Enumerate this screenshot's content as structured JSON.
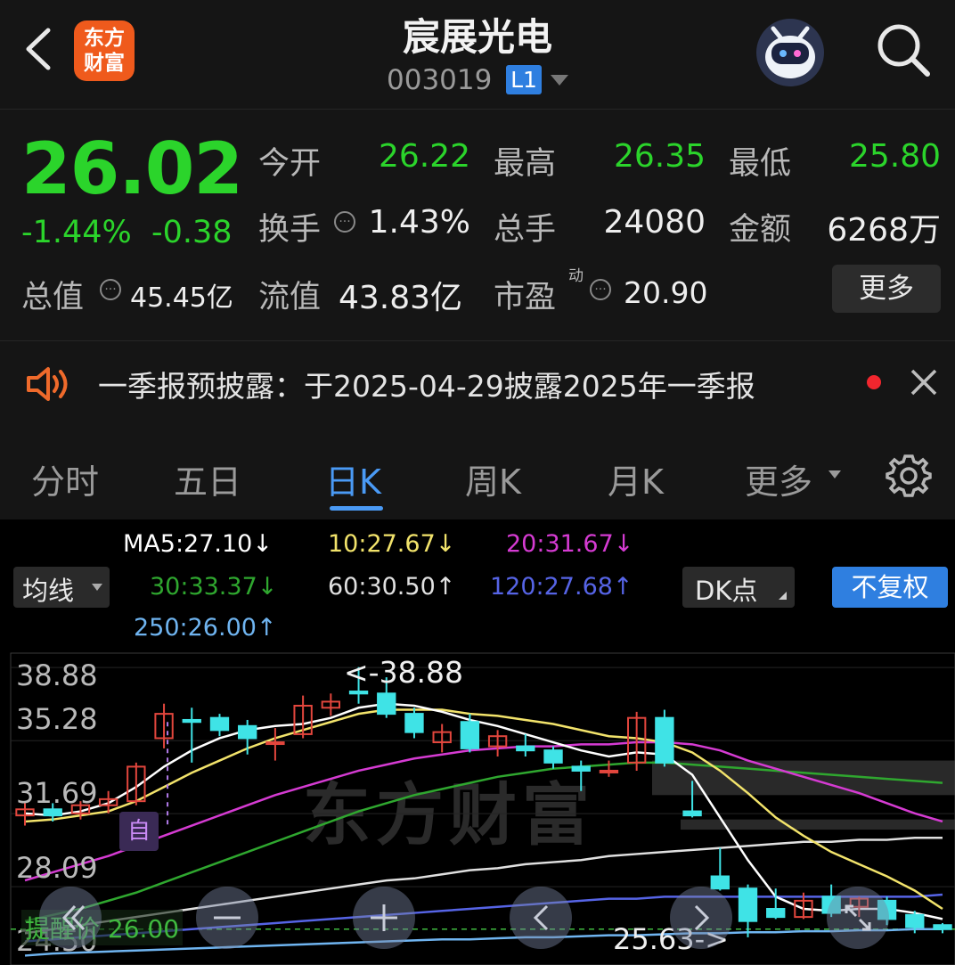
{
  "header": {
    "title": "宸展光电",
    "code": "003019",
    "level_badge": "L1",
    "logo_line1": "东方",
    "logo_line2": "财富"
  },
  "quote": {
    "price": "26.02",
    "change_pct": "-1.44%",
    "change": "-0.38",
    "open_label": "今开",
    "open": "26.22",
    "high_label": "最高",
    "high": "26.35",
    "low_label": "最低",
    "low": "25.80",
    "turnover_label": "换手",
    "turnover": "1.43%",
    "volume_label": "总手",
    "volume": "24080",
    "amount_label": "金额",
    "amount": "6268万",
    "mktcap_label": "总值",
    "mktcap": "45.45亿",
    "float_label": "流值",
    "float_cap": "43.83亿",
    "pe_label": "市盈",
    "pe_sup": "动",
    "pe": "20.90",
    "more_label": "更多"
  },
  "notice": {
    "text": "一季报预披露：于2025-04-29披露2025年一季报"
  },
  "tabs": {
    "items": [
      "分时",
      "五日",
      "日K",
      "周K",
      "月K"
    ],
    "active": "日K",
    "more_label": "更多"
  },
  "indicators": {
    "ma_select_label": "均线",
    "dk_label": "DK点",
    "adjust_label": "不复权",
    "ma5": "MA5:27.10↓",
    "ma10": "10:27.67↓",
    "ma20": "20:31.67↓",
    "ma30": "30:33.37↓",
    "ma60": "60:30.50↑",
    "ma120": "120:27.68↑",
    "ma250": "250:26.00↑",
    "colors": {
      "ma5": "#ffffff",
      "ma10": "#f2e36b",
      "ma20": "#d53bd2",
      "ma30": "#2fa72f",
      "ma60": "#e0e0e0",
      "ma120": "#5664e6",
      "ma250": "#6fb4f0",
      "up": "#e2463d",
      "down": "#3fe3e6"
    }
  },
  "chart": {
    "y_labels": [
      "38.88",
      "35.28",
      "31.69",
      "28.09",
      "24.50"
    ],
    "high_marker": "38.88",
    "low_marker": "25.63->",
    "alert_label": "提醒价 26.00",
    "self_badge": "自",
    "watermark": "东方财富"
  },
  "chart_data": {
    "type": "candlestick",
    "ylim": [
      24.5,
      39.5
    ],
    "candles": [
      {
        "o": 31.6,
        "c": 31.9,
        "h": 32.2,
        "l": 31.1
      },
      {
        "o": 31.9,
        "c": 31.6,
        "h": 32.2,
        "l": 31.3
      },
      {
        "o": 31.7,
        "c": 32.1,
        "h": 32.3,
        "l": 31.4
      },
      {
        "o": 32.1,
        "c": 32.4,
        "h": 32.8,
        "l": 31.7
      },
      {
        "o": 32.3,
        "c": 34.0,
        "h": 34.2,
        "l": 32.1
      },
      {
        "o": 35.4,
        "c": 36.6,
        "h": 37.1,
        "l": 34.9
      },
      {
        "o": 36.3,
        "c": 36.2,
        "h": 36.9,
        "l": 34.2
      },
      {
        "o": 36.4,
        "c": 35.8,
        "h": 36.6,
        "l": 35.5
      },
      {
        "o": 36.0,
        "c": 35.4,
        "h": 36.3,
        "l": 34.6
      },
      {
        "o": 35.2,
        "c": 35.2,
        "h": 35.9,
        "l": 34.3
      },
      {
        "o": 35.6,
        "c": 37.0,
        "h": 37.5,
        "l": 35.4
      },
      {
        "o": 36.9,
        "c": 37.2,
        "h": 37.6,
        "l": 36.5
      },
      {
        "o": 37.7,
        "c": 37.6,
        "h": 38.9,
        "l": 37.1
      },
      {
        "o": 37.6,
        "c": 36.6,
        "h": 38.4,
        "l": 36.4
      },
      {
        "o": 36.6,
        "c": 35.7,
        "h": 36.9,
        "l": 35.4
      },
      {
        "o": 35.2,
        "c": 35.7,
        "h": 36.1,
        "l": 34.7
      },
      {
        "o": 36.2,
        "c": 34.9,
        "h": 36.6,
        "l": 34.7
      },
      {
        "o": 35.0,
        "c": 35.5,
        "h": 35.8,
        "l": 34.5
      },
      {
        "o": 35.0,
        "c": 34.8,
        "h": 35.6,
        "l": 34.5
      },
      {
        "o": 34.8,
        "c": 34.2,
        "h": 35.0,
        "l": 33.9
      },
      {
        "o": 34.0,
        "c": 33.8,
        "h": 34.3,
        "l": 32.8
      },
      {
        "o": 33.8,
        "c": 33.8,
        "h": 34.3,
        "l": 33.5
      },
      {
        "o": 34.2,
        "c": 36.4,
        "h": 36.7,
        "l": 33.8
      },
      {
        "o": 36.4,
        "c": 34.2,
        "h": 36.8,
        "l": 34.0
      },
      {
        "o": 31.8,
        "c": 31.6,
        "h": 33.3,
        "l": 31.5
      },
      {
        "o": 28.6,
        "c": 28.0,
        "h": 30.0,
        "l": 27.9
      },
      {
        "o": 28.0,
        "c": 26.4,
        "h": 28.2,
        "l": 25.6
      },
      {
        "o": 27.0,
        "c": 26.6,
        "h": 28.0,
        "l": 26.5
      },
      {
        "o": 26.6,
        "c": 27.4,
        "h": 27.8,
        "l": 26.5
      },
      {
        "o": 27.6,
        "c": 26.8,
        "h": 28.2,
        "l": 26.6
      },
      {
        "o": 27.1,
        "c": 27.5,
        "h": 27.6,
        "l": 26.6
      },
      {
        "o": 27.4,
        "c": 26.5,
        "h": 27.6,
        "l": 26.2
      },
      {
        "o": 26.7,
        "c": 26.1,
        "h": 26.9,
        "l": 25.8
      },
      {
        "o": 26.2,
        "c": 26.0,
        "h": 26.3,
        "l": 25.8
      }
    ],
    "ma_lines": {
      "ma5": [
        31.7,
        31.6,
        31.8,
        32.2,
        33.0,
        34.0,
        34.8,
        35.4,
        35.8,
        36.0,
        36.1,
        36.4,
        36.9,
        37.1,
        37.0,
        36.7,
        36.3,
        36.0,
        35.6,
        35.2,
        34.8,
        34.5,
        34.7,
        34.6,
        33.6,
        31.5,
        29.4,
        27.6,
        27.0,
        26.9,
        27.0,
        27.0,
        26.8,
        26.5
      ],
      "ma10": [
        31.3,
        31.4,
        31.6,
        31.8,
        32.3,
        33.0,
        33.7,
        34.3,
        34.9,
        35.4,
        35.8,
        36.2,
        36.6,
        36.8,
        36.8,
        36.8,
        36.6,
        36.5,
        36.3,
        36.1,
        35.8,
        35.5,
        35.4,
        35.2,
        34.7,
        33.8,
        32.7,
        31.5,
        30.6,
        29.8,
        29.2,
        28.6,
        27.9,
        27.0
      ],
      "ma20": [
        28.4,
        28.8,
        29.2,
        29.6,
        30.1,
        30.6,
        31.1,
        31.6,
        32.1,
        32.6,
        33.0,
        33.4,
        33.8,
        34.1,
        34.4,
        34.6,
        34.8,
        34.9,
        35.0,
        35.0,
        35.1,
        35.1,
        35.2,
        35.2,
        35.1,
        34.8,
        34.3,
        33.9,
        33.5,
        33.1,
        32.7,
        32.2,
        31.7,
        31.3
      ],
      "ma30": [
        26.4,
        26.7,
        27.0,
        27.4,
        27.8,
        28.3,
        28.8,
        29.3,
        29.8,
        30.3,
        30.8,
        31.3,
        31.8,
        32.2,
        32.6,
        32.9,
        33.2,
        33.5,
        33.7,
        33.9,
        34.0,
        34.1,
        34.2,
        34.2,
        34.1,
        34.0,
        33.9,
        33.8,
        33.7,
        33.6,
        33.5,
        33.4,
        33.3,
        33.2
      ],
      "ma60": [
        25.8,
        26.0,
        26.2,
        26.4,
        26.6,
        26.8,
        27.0,
        27.2,
        27.4,
        27.6,
        27.8,
        28.0,
        28.2,
        28.4,
        28.5,
        28.7,
        28.9,
        29.0,
        29.2,
        29.3,
        29.4,
        29.6,
        29.7,
        29.8,
        29.9,
        30.0,
        30.1,
        30.2,
        30.3,
        30.3,
        30.4,
        30.4,
        30.5,
        30.5
      ],
      "ma120": [
        25.4,
        25.5,
        25.6,
        25.7,
        25.8,
        25.9,
        26.0,
        26.1,
        26.2,
        26.3,
        26.4,
        26.5,
        26.6,
        26.7,
        26.8,
        26.9,
        27.0,
        27.1,
        27.2,
        27.3,
        27.4,
        27.5,
        27.5,
        27.6,
        27.6,
        27.6,
        27.6,
        27.6,
        27.6,
        27.6,
        27.6,
        27.6,
        27.6,
        27.7
      ],
      "ma250": [
        24.7,
        24.8,
        24.85,
        24.9,
        24.95,
        25.0,
        25.05,
        25.1,
        25.15,
        25.2,
        25.25,
        25.3,
        25.35,
        25.4,
        25.45,
        25.5,
        25.5,
        25.55,
        25.6,
        25.6,
        25.65,
        25.7,
        25.7,
        25.75,
        25.8,
        25.8,
        25.85,
        25.85,
        25.9,
        25.9,
        25.95,
        25.95,
        26.0,
        26.0
      ]
    }
  }
}
